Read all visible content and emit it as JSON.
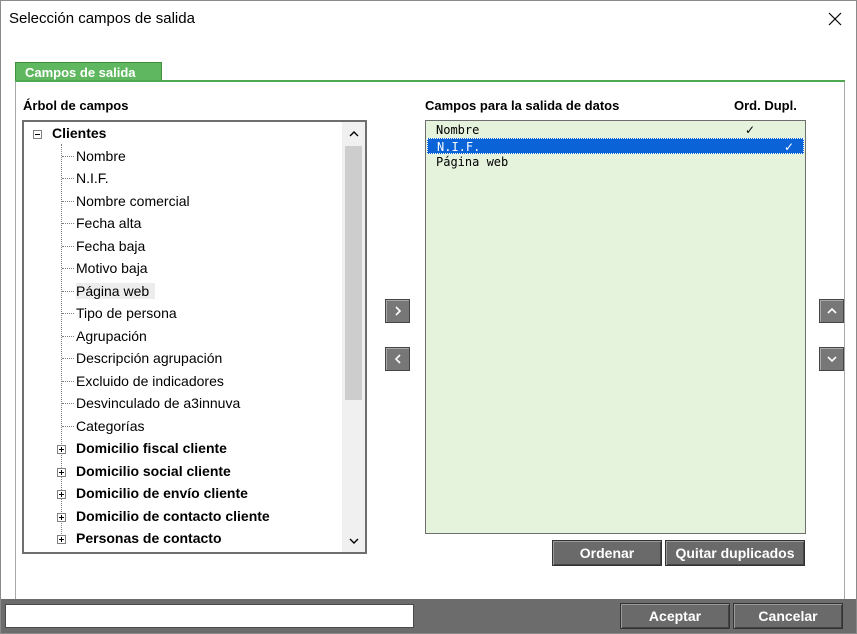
{
  "window": {
    "title": "Selección campos de salida"
  },
  "tab": {
    "label": "Campos de salida"
  },
  "tree": {
    "heading": "Árbol de campos",
    "root": "Clientes",
    "children": [
      "Nombre",
      "N.I.F.",
      "Nombre comercial",
      "Fecha alta",
      "Fecha baja",
      "Motivo baja",
      "Página web",
      "Tipo de persona",
      "Agrupación",
      "Descripción agrupación",
      "Excluido de indicadores",
      "Desvinculado de a3innuva",
      "Categorías"
    ],
    "groups": [
      "Domicilio fiscal cliente",
      "Domicilio social cliente",
      "Domicilio de envío cliente",
      "Domicilio de contacto cliente",
      "Personas de contacto"
    ],
    "highlighted": "Página web"
  },
  "output": {
    "heading": "Campos para la salida de datos",
    "col_headers": "Ord. Dupl.",
    "rows": [
      {
        "name": "Nombre",
        "ord": "✓",
        "dupl": ""
      },
      {
        "name": "N.I.F.",
        "ord": "",
        "dupl": "✓"
      },
      {
        "name": "Página web",
        "ord": "",
        "dupl": ""
      }
    ],
    "selected_index": 1
  },
  "buttons": {
    "add": ">",
    "remove": "<",
    "up": "^",
    "down": "v",
    "sort": "Ordenar",
    "remove_duplicates": "Quitar duplicados",
    "accept": "Aceptar",
    "cancel": "Cancelar"
  },
  "footer": {
    "input_value": ""
  },
  "colors": {
    "tab_green": "#5fb85f",
    "list_bg": "#e5f3dd",
    "selection_blue": "#0a64d8",
    "button_gray": "#6a6a6a"
  }
}
